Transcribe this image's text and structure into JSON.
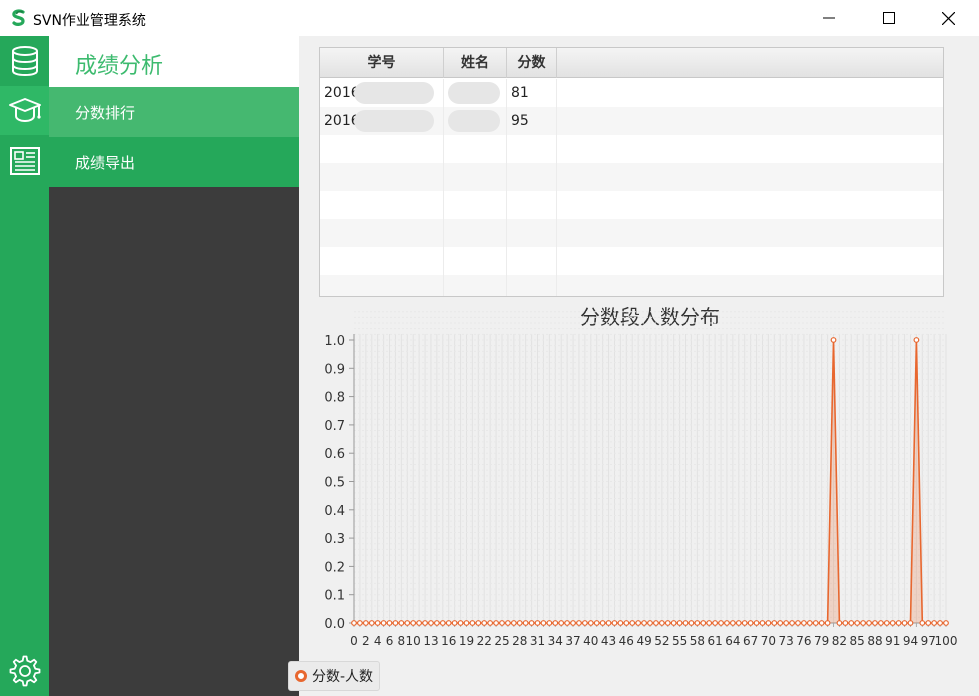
{
  "window": {
    "title": "SVN作业管理系统",
    "app_icon": "svn-logo-icon",
    "controls": [
      "minimize-icon",
      "maximize-icon",
      "close-icon"
    ]
  },
  "iconbar": {
    "items": [
      {
        "icon": "database-icon"
      },
      {
        "icon": "graduation-cap-icon"
      },
      {
        "icon": "document-icon"
      }
    ],
    "settings_icon": "gear-icon"
  },
  "nav": {
    "header": "成绩分析",
    "items": [
      {
        "label": "分数排行",
        "active": true
      },
      {
        "label": "成绩导出",
        "active": false
      }
    ]
  },
  "table": {
    "columns": [
      "学号",
      "姓名",
      "分数"
    ],
    "rows": [
      {
        "id": "2016",
        "name": "",
        "score": "81"
      },
      {
        "id": "2016",
        "name": "",
        "score": "95"
      }
    ]
  },
  "chart_data": {
    "type": "area",
    "title": "分数段人数分布",
    "xlabel": "",
    "ylabel": "",
    "xlim": [
      0,
      100
    ],
    "ylim": [
      0,
      1.0
    ],
    "yticks": [
      "0.0",
      "0.1",
      "0.2",
      "0.3",
      "0.4",
      "0.5",
      "0.6",
      "0.7",
      "0.8",
      "0.9",
      "1.0"
    ],
    "xticks": [
      "0",
      "2",
      "4",
      "6",
      "8",
      "10",
      "13",
      "16",
      "19",
      "22",
      "25",
      "28",
      "31",
      "34",
      "37",
      "40",
      "43",
      "46",
      "49",
      "52",
      "55",
      "58",
      "61",
      "64",
      "67",
      "70",
      "73",
      "76",
      "79",
      "82",
      "85",
      "88",
      "91",
      "94",
      "97",
      "100"
    ],
    "series": [
      {
        "name": "分数-人数",
        "color": "#e8672f",
        "points": [
          {
            "x": 81,
            "y": 1
          },
          {
            "x": 95,
            "y": 1
          }
        ]
      }
    ],
    "grid": true,
    "legend": "bottom"
  },
  "colors": {
    "accent": "#25a85a",
    "accent_light": "#2fb866",
    "header_text": "#3dbb6f",
    "nav_bg": "#3c3c3c",
    "series": "#e8672f"
  }
}
